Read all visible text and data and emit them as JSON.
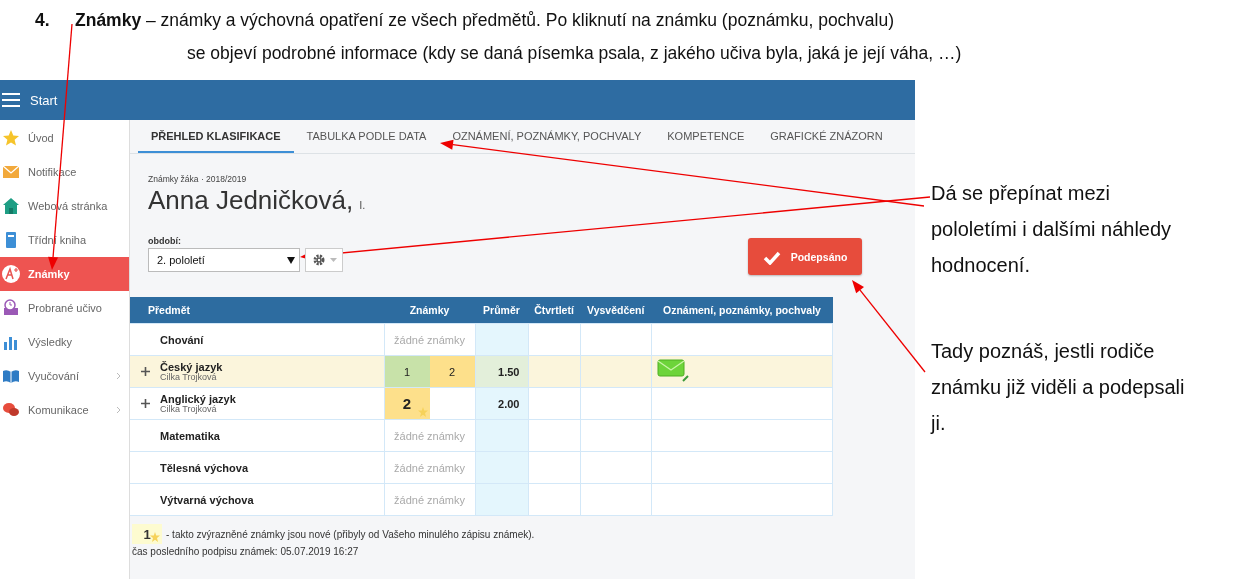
{
  "document": {
    "number": "4.",
    "lines": [
      "**Známky** – známky a výchovná opatření ze všech předmětů. Po kliknutí na známku (poznámku, pochvalu)",
      "se objeví podrobné informace (kdy se daná písemka psala, z jakého učiva byla, jaká je její váha, …)"
    ]
  },
  "app": {
    "title": "Start",
    "sidebar": {
      "items": [
        {
          "label": "Úvod",
          "selected": false,
          "expandable": false
        },
        {
          "label": "Notifikace",
          "selected": false,
          "expandable": false
        },
        {
          "label": "Webová stránka",
          "selected": false,
          "expandable": false
        },
        {
          "label": "Třídní kniha",
          "selected": false,
          "expandable": false
        },
        {
          "label": "Známky",
          "selected": true,
          "expandable": false
        },
        {
          "label": "Probrané učivo",
          "selected": false,
          "expandable": false
        },
        {
          "label": "Výsledky",
          "selected": false,
          "expandable": false
        },
        {
          "label": "Vyučování",
          "selected": false,
          "expandable": true
        },
        {
          "label": "Komunikace",
          "selected": false,
          "expandable": true
        }
      ]
    },
    "tabs": [
      {
        "label": "PŘEHLED KLASIFIKACE",
        "selected": true
      },
      {
        "label": "TABULKA PODLE DATA",
        "selected": false
      },
      {
        "label": "OZNÁMENÍ, POZNÁMKY, POCHVALY",
        "selected": false
      },
      {
        "label": "KOMPETENCE",
        "selected": false
      },
      {
        "label": "GRAFICKÉ ZNÁZORN",
        "selected": false
      }
    ],
    "student": {
      "caption": "Známky žáka · 2018/2019",
      "name": "Anna Jedničková,",
      "class": "I."
    },
    "period": {
      "label": "období:",
      "value": "2. pololetí"
    },
    "sign_button": "Podepsáno",
    "table": {
      "columns": [
        "Předmět",
        "Známky",
        "Průměr",
        "Čtvrtletí",
        "Vysvědčení",
        "Oznámení, poznámky, pochvaly"
      ],
      "rows": [
        {
          "subject": "Chování",
          "selected": false,
          "expandable": false,
          "grades": [],
          "empty": "žádné známky",
          "notice": false
        },
        {
          "subject": "Český jazyk",
          "teacher": "Cilka Trojková",
          "selected": true,
          "expandable": true,
          "grades": [
            {
              "value": "1",
              "color": "#c8e2a9",
              "new": false
            },
            {
              "value": "2",
              "color": "#fde08b",
              "new": false
            }
          ],
          "average": "1.50",
          "notice": true
        },
        {
          "subject": "Anglický jazyk",
          "teacher": "Cilka Trojková",
          "selected": false,
          "expandable": true,
          "grades": [
            {
              "value": "2",
              "color": "#fde08b",
              "new": true
            }
          ],
          "average": "2.00",
          "notice": false
        },
        {
          "subject": "Matematika",
          "selected": false,
          "expandable": false,
          "grades": [],
          "empty": "žádné známky",
          "notice": false
        },
        {
          "subject": "Tělesná výchova",
          "selected": false,
          "expandable": false,
          "grades": [],
          "empty": "žádné známky",
          "notice": false
        },
        {
          "subject": "Výtvarná výchova",
          "selected": false,
          "expandable": false,
          "grades": [],
          "empty": "žádné známky",
          "notice": false
        }
      ]
    },
    "legend": {
      "sample": "1",
      "text": "- takto zvýrazněné známky jsou nové (přibyly od Vašeho minulého zápisu známek)."
    },
    "last_signature": "čas posledního podpisu známek: 05.07.2019 16:27"
  },
  "notes": [
    {
      "lines": [
        "Dá se přepínat mezi",
        "pololetími i dalšími náhledy",
        "hodnocení."
      ]
    },
    {
      "lines": [
        "Tady poznáš, jestli rodiče",
        "známku již viděli a podepsali",
        "ji."
      ]
    }
  ]
}
